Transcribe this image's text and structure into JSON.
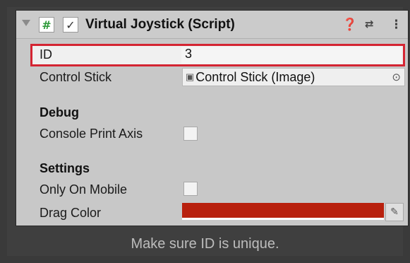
{
  "header": {
    "title": "Virtual Joystick (Script)",
    "script_icon_glyph": "#",
    "checkbox_glyph": "✓",
    "icons": [
      "help-icon",
      "presets-icon",
      "more-options-icon"
    ]
  },
  "fields": {
    "id": {
      "label": "ID",
      "value": "3"
    },
    "control_stick": {
      "label": "Control Stick",
      "value": "Control Stick (Image)"
    }
  },
  "debug": {
    "heading": "Debug",
    "console_print_axis": {
      "label": "Console Print Axis",
      "checked": false
    }
  },
  "settings": {
    "heading": "Settings",
    "only_on_mobile": {
      "label": "Only On Mobile",
      "checked": false
    },
    "drag_color": {
      "label": "Drag Color",
      "color": "#b8200d"
    }
  },
  "caption": "Make sure ID is unique.",
  "colors": {
    "highlight": "#d42432",
    "panel": "#c8c8c8",
    "background": "#3a3a3a"
  }
}
